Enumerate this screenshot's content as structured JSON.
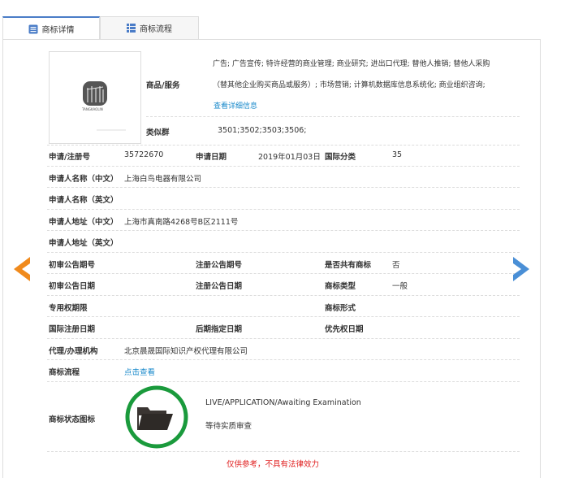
{
  "tabs": [
    {
      "label": "商标详情",
      "icon": "list-icon",
      "active": true
    },
    {
      "label": "商标流程",
      "icon": "grid-icon",
      "active": false
    }
  ],
  "logo": {
    "text": "TANGKAOLIN"
  },
  "goods": {
    "label": "商品/服务",
    "line1": "广告; 广告宣传; 特许经营的商业管理; 商业研究; 进出口代理; 替他人推销; 替他人采购",
    "line2": "（替其他企业购买商品或服务）; 市场营销; 计算机数据库信息系统化; 商业组织咨询;",
    "link": "查看详细信息"
  },
  "similar": {
    "label": "类似群",
    "value": "3501;3502;3503;3506;"
  },
  "fields": {
    "reg_no": {
      "label": "申请/注册号",
      "value": "35722670"
    },
    "app_date": {
      "label": "申请日期",
      "value": "2019年01月03日"
    },
    "intl_class": {
      "label": "国际分类",
      "value": "35"
    },
    "name_cn": {
      "label": "申请人名称（中文）",
      "value": "上海白鸟电器有限公司"
    },
    "name_en": {
      "label": "申请人名称（英文）",
      "value": ""
    },
    "addr_cn": {
      "label": "申请人地址（中文）",
      "value": "上海市真南路4268号B区2111号"
    },
    "addr_en": {
      "label": "申请人地址（英文）",
      "value": ""
    },
    "prelim_no": {
      "label": "初审公告期号",
      "value": ""
    },
    "reg_pub_no": {
      "label": "注册公告期号",
      "value": ""
    },
    "shared": {
      "label": "是否共有商标",
      "value": "否"
    },
    "prelim_date": {
      "label": "初审公告日期",
      "value": ""
    },
    "reg_pub_date": {
      "label": "注册公告日期",
      "value": ""
    },
    "tm_type": {
      "label": "商标类型",
      "value": "一般"
    },
    "exclusive": {
      "label": "专用权期限",
      "value": ""
    },
    "tm_form": {
      "label": "商标形式",
      "value": ""
    },
    "intl_reg_date": {
      "label": "国际注册日期",
      "value": ""
    },
    "later_date": {
      "label": "后期指定日期",
      "value": ""
    },
    "priority_date": {
      "label": "优先权日期",
      "value": ""
    },
    "agent": {
      "label": "代理/办理机构",
      "value": "北京晨晟国际知识产权代理有限公司"
    },
    "flow": {
      "label": "商标流程",
      "value": "点击查看"
    }
  },
  "status": {
    "label": "商标状态图标",
    "en": "LIVE/APPLICATION/Awaiting Examination",
    "cn": "等待实质审查",
    "ring_color": "#1a9a3c"
  },
  "disclaimer": "仅供参考，不具有法律效力",
  "colors": {
    "prev_arrow": "#f08a1c",
    "next_arrow": "#4a8fd6",
    "link": "#1a8acb",
    "disclaimer": "#e02020"
  }
}
